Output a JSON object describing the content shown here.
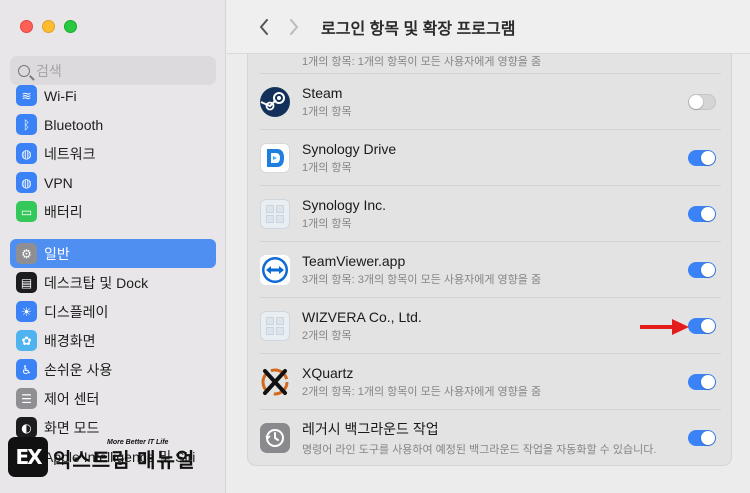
{
  "window": {
    "title": "로그인 항목 및 확장 프로그램"
  },
  "search": {
    "placeholder": "검색"
  },
  "sidebar": {
    "items": [
      {
        "label": "Wi-Fi",
        "icon": "wifi-icon",
        "color": "#3b82f6"
      },
      {
        "label": "Bluetooth",
        "icon": "bluetooth-icon",
        "color": "#3b82f6"
      },
      {
        "label": "네트워크",
        "icon": "globe-icon",
        "color": "#3b82f6"
      },
      {
        "label": "VPN",
        "icon": "globe-icon",
        "color": "#3b82f6"
      },
      {
        "label": "배터리",
        "icon": "battery-icon",
        "color": "#34c759"
      },
      {
        "label": "일반",
        "icon": "gear-icon",
        "color": "#8e8e93",
        "selected": true
      },
      {
        "label": "데스크탑 및 Dock",
        "icon": "dock-icon",
        "color": "#1c1c1e"
      },
      {
        "label": "디스플레이",
        "icon": "sun-icon",
        "color": "#3b82f6"
      },
      {
        "label": "배경화면",
        "icon": "flower-icon",
        "color": "#4fb3f0"
      },
      {
        "label": "손쉬운 사용",
        "icon": "accessibility-icon",
        "color": "#3b82f6"
      },
      {
        "label": "제어 센터",
        "icon": "toggles-icon",
        "color": "#8e8e93"
      },
      {
        "label": "화면 모드",
        "icon": "appearance-icon",
        "color": "#1c1c1e"
      },
      {
        "label": "Apple Intelligence 및 Siri",
        "icon": "siri-icon",
        "color": "#8e44ad"
      }
    ]
  },
  "items": [
    {
      "name": "",
      "sub": "1개의 항목: 1개의 항목이 모든 사용자에게 영향을 줌",
      "icon": "partial-app-icon",
      "enabled": null
    },
    {
      "name": "Steam",
      "sub": "1개의 항목",
      "icon": "steam-icon",
      "enabled": false
    },
    {
      "name": "Synology Drive",
      "sub": "1개의 항목",
      "icon": "synology-drive-icon",
      "enabled": true
    },
    {
      "name": "Synology Inc.",
      "sub": "1개의 항목",
      "icon": "generic-app-icon",
      "enabled": true
    },
    {
      "name": "TeamViewer.app",
      "sub": "3개의 항목: 3개의 항목이 모든 사용자에게 영향을 줌",
      "icon": "teamviewer-icon",
      "enabled": true
    },
    {
      "name": "WIZVERA Co., Ltd.",
      "sub": "2개의 항목",
      "icon": "generic-app-icon",
      "enabled": true
    },
    {
      "name": "XQuartz",
      "sub": "2개의 항목: 1개의 항목이 모든 사용자에게 영향을 줌",
      "icon": "xquartz-icon",
      "enabled": true
    },
    {
      "name": "레거시 백그라운드 작업",
      "sub": "명령어 라인 도구를 사용하여 예정된 백그라운드 작업을 자동화할 수 있습니다.",
      "icon": "legacy-background-icon",
      "enabled": true
    }
  ],
  "watermark": {
    "logo": "EX",
    "small": "More Better IT Life",
    "big": "익스트림 매뉴얼"
  },
  "colors": {
    "accent": "#3a82f6",
    "selected": "#4f8ff2",
    "arrow": "#e31c1c"
  }
}
